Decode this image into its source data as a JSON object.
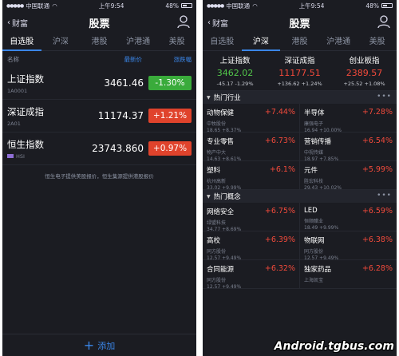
{
  "status": {
    "carrier": "中国联通",
    "time": "上午9:54",
    "battery": "48%"
  },
  "nav": {
    "back_label": "财富",
    "title": "股票"
  },
  "tabs": [
    "自选股",
    "沪深",
    "港股",
    "沪港通",
    "美股"
  ],
  "left": {
    "header": {
      "name": "名称",
      "price": "最新价",
      "change": "涨跌幅"
    },
    "rows": [
      {
        "name": "上证指数",
        "code": "1A0001",
        "price": "3461.46",
        "change": "-1.30%"
      },
      {
        "name": "深证成指",
        "code": "2A01",
        "price": "11174.37",
        "change": "+1.21%"
      },
      {
        "name": "恒生指数",
        "code": "HSI",
        "price": "23743.860",
        "change": "+0.97%"
      }
    ],
    "note": "恒生电子提供美股报价，恒生集源提供港股报价",
    "add_label": "添加"
  },
  "right": {
    "indices": [
      {
        "name": "上证指数",
        "value": "3462.02",
        "change": "-45.17 -1.29%"
      },
      {
        "name": "深证成指",
        "value": "11177.51",
        "change": "+136.62 +1.24%"
      },
      {
        "name": "创业板指",
        "value": "2389.57",
        "change": "+25.52 +1.08%"
      }
    ],
    "sections": [
      {
        "title": "热门行业",
        "rows": [
          [
            {
              "name": "动物保健",
              "change": "+7.44%",
              "sub": "中牧股份",
              "meta": "18.65 +8.37%"
            },
            {
              "name": "半导体",
              "change": "+7.28%",
              "sub": "康强电子",
              "meta": "16.94 +10.00%"
            }
          ],
          [
            {
              "name": "专业零售",
              "change": "+6.73%",
              "sub": "物产中大",
              "meta": "14.63 +8.61%"
            },
            {
              "name": "营销传播",
              "change": "+6.54%",
              "sub": "中视传媒",
              "meta": "18.97 +7.85%"
            }
          ],
          [
            {
              "name": "塑料",
              "change": "+6.1%",
              "sub": "杭州高新",
              "meta": "33.02 +9.99%"
            },
            {
              "name": "元件",
              "change": "+5.99%",
              "sub": "胜宏科技",
              "meta": "29.43 +10.02%"
            }
          ]
        ]
      },
      {
        "title": "热门概念",
        "rows": [
          [
            {
              "name": "网络安全",
              "change": "+6.75%",
              "sub": "绿盟科技",
              "meta": "34.77 +8.69%"
            },
            {
              "name": "LED",
              "change": "+6.59%",
              "sub": "恒顺醋业",
              "meta": "18.49 +9.99%"
            }
          ],
          [
            {
              "name": "高校",
              "change": "+6.39%",
              "sub": "同方股份",
              "meta": "12.57 +9.49%"
            },
            {
              "name": "物联网",
              "change": "+6.38%",
              "sub": "同方股份",
              "meta": "12.57 +9.49%"
            }
          ],
          [
            {
              "name": "合同能源",
              "change": "+6.32%",
              "sub": "同方股份",
              "meta": "12.57 +9.49%"
            },
            {
              "name": "独家药品",
              "change": "+6.28%",
              "sub": "上海凯宝",
              "meta": ""
            }
          ]
        ]
      }
    ]
  },
  "watermark": "Android.tgbus.com",
  "colors": {
    "up": "#f24a3b",
    "down": "#52c64a",
    "accent": "#3a86e8",
    "bg": "#1b1c22"
  }
}
